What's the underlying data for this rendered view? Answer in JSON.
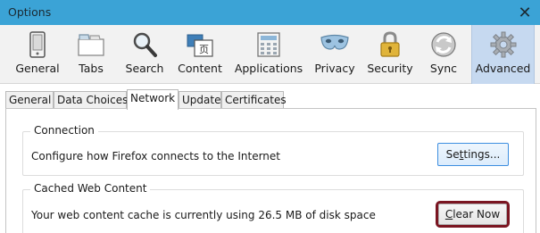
{
  "window": {
    "title": "Options",
    "close_glyph": "✕"
  },
  "toolbar": {
    "items": [
      {
        "label": "General",
        "icon": "general-icon"
      },
      {
        "label": "Tabs",
        "icon": "tabs-icon"
      },
      {
        "label": "Search",
        "icon": "search-icon"
      },
      {
        "label": "Content",
        "icon": "content-icon"
      },
      {
        "label": "Applications",
        "icon": "applications-icon"
      },
      {
        "label": "Privacy",
        "icon": "privacy-mask-icon"
      },
      {
        "label": "Security",
        "icon": "padlock-icon"
      },
      {
        "label": "Sync",
        "icon": "sync-icon"
      },
      {
        "label": "Advanced",
        "icon": "gear-icon"
      }
    ],
    "selected": "Advanced"
  },
  "subtabs": {
    "items": [
      "General",
      "Data Choices",
      "Network",
      "Update",
      "Certificates"
    ],
    "selected": "Network"
  },
  "connection": {
    "legend": "Connection",
    "description": "Configure how Firefox connects to the Internet",
    "button_pre": "Se",
    "button_accel": "t",
    "button_post": "tings..."
  },
  "cache": {
    "legend": "Cached Web Content",
    "description": "Your web content cache is currently using 26.5 MB of disk space",
    "button_accel": "C",
    "button_post": "lear Now"
  },
  "colors": {
    "titlebar": "#3ba3d6",
    "selected_toolbar": "#c6d9f0",
    "highlight_outline": "#7a1521"
  }
}
